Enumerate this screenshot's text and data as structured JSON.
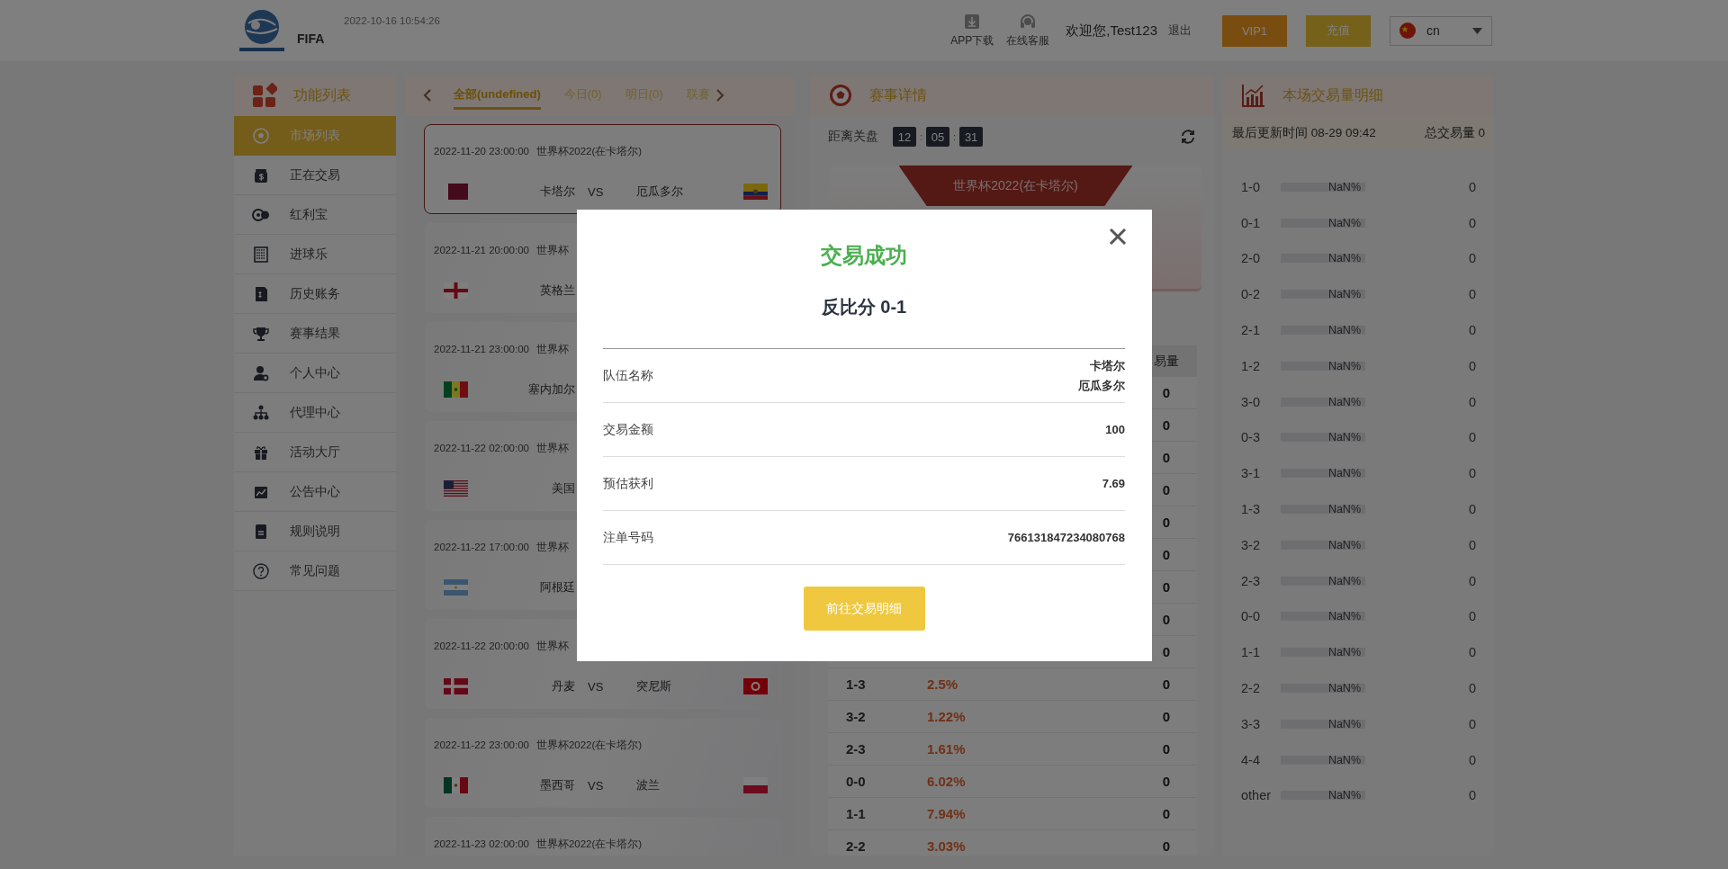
{
  "header": {
    "site_name": "FIFA",
    "datetime": "2022-10-16 10:54:26",
    "links": [
      {
        "label": "APP下载"
      },
      {
        "label": "在线客服"
      }
    ],
    "greeting": "欢迎您,Test123",
    "logout": "退出",
    "buttons": [
      {
        "label": "VIP1",
        "kind": "vip"
      },
      {
        "label": "充值",
        "kind": "recharge"
      }
    ],
    "language": "cn"
  },
  "sidebar": {
    "title": "功能列表",
    "items": [
      {
        "label": "市场列表",
        "selected": true
      },
      {
        "label": "正在交易",
        "selected": false
      },
      {
        "label": "红利宝",
        "selected": false
      },
      {
        "label": "进球乐",
        "selected": false
      },
      {
        "label": "历史账务",
        "selected": false
      },
      {
        "label": "赛事结果",
        "selected": false
      },
      {
        "label": "个人中心",
        "selected": false
      },
      {
        "label": "代理中心",
        "selected": false
      },
      {
        "label": "活动大厅",
        "selected": false
      },
      {
        "label": "公告中心",
        "selected": false
      },
      {
        "label": "规则说明",
        "selected": false
      },
      {
        "label": "常见问题",
        "selected": false
      }
    ]
  },
  "match_list": {
    "tabs": [
      {
        "label": "全部(undefined)",
        "selected": true
      },
      {
        "label": "今日(0)",
        "selected": false
      },
      {
        "label": "明日(0)",
        "selected": false
      },
      {
        "label": "联赛",
        "selected": false
      }
    ],
    "matches": [
      {
        "time": "2022-11-20 23:00:00",
        "league": "世界杯2022(在卡塔尔)",
        "home": "卡塔尔",
        "vs": "VS",
        "away": "厄瓜多尔",
        "selected": true
      },
      {
        "time": "2022-11-21 20:00:00",
        "league": "世界杯",
        "home": "英格兰",
        "selected": false
      },
      {
        "time": "2022-11-21 23:00:00",
        "league": "世界杯",
        "home": "塞内加尔",
        "selected": false
      },
      {
        "time": "2022-11-22 02:00:00",
        "league": "世界杯",
        "home": "美国",
        "selected": false
      },
      {
        "time": "2022-11-22 17:00:00",
        "league": "世界杯",
        "home": "阿根廷",
        "selected": false
      },
      {
        "time": "2022-11-22 20:00:00",
        "league": "世界杯",
        "home": "丹麦",
        "vs": "VS",
        "away": "突尼斯",
        "selected": false
      },
      {
        "time": "2022-11-22 23:00:00",
        "league": "世界杯2022(在卡塔尔)",
        "home": "墨西哥",
        "vs": "VS",
        "away": "波兰",
        "selected": false
      },
      {
        "time": "2022-11-23 02:00:00",
        "league": "世界杯2022(在卡塔尔)",
        "selected": false
      }
    ]
  },
  "match_detail": {
    "title": "赛事详情",
    "countdown": {
      "label": "距离关盘",
      "parts": [
        "12",
        "05",
        "31"
      ],
      "separator": ":"
    },
    "banner": "世界杯2022(在卡塔尔)",
    "table": {
      "header_volume": "易量",
      "rows": [
        {
          "volume": "0"
        },
        {
          "volume": "0"
        },
        {
          "volume": "0"
        },
        {
          "volume": "0"
        },
        {
          "volume": "0"
        },
        {
          "volume": "0"
        },
        {
          "volume": "0"
        },
        {
          "volume": "0"
        },
        {
          "volume": "0"
        },
        {
          "score": "1-3",
          "odds": "2.5%",
          "volume": "0"
        },
        {
          "score": "3-2",
          "odds": "1.22%",
          "volume": "0"
        },
        {
          "score": "2-3",
          "odds": "1.61%",
          "volume": "0"
        },
        {
          "score": "0-0",
          "odds": "6.02%",
          "volume": "0"
        },
        {
          "score": "1-1",
          "odds": "7.94%",
          "volume": "0"
        },
        {
          "score": "2-2",
          "odds": "3.03%",
          "volume": "0"
        }
      ]
    }
  },
  "volume_panel": {
    "title": "本场交易量明细",
    "updated": "最后更新时间 08-29 09:42",
    "total": "总交易量 0",
    "rows": [
      {
        "score": "1-0",
        "percent": "NaN%",
        "volume": "0"
      },
      {
        "score": "0-1",
        "percent": "NaN%",
        "volume": "0"
      },
      {
        "score": "2-0",
        "percent": "NaN%",
        "volume": "0"
      },
      {
        "score": "0-2",
        "percent": "NaN%",
        "volume": "0"
      },
      {
        "score": "2-1",
        "percent": "NaN%",
        "volume": "0"
      },
      {
        "score": "1-2",
        "percent": "NaN%",
        "volume": "0"
      },
      {
        "score": "3-0",
        "percent": "NaN%",
        "volume": "0"
      },
      {
        "score": "0-3",
        "percent": "NaN%",
        "volume": "0"
      },
      {
        "score": "3-1",
        "percent": "NaN%",
        "volume": "0"
      },
      {
        "score": "1-3",
        "percent": "NaN%",
        "volume": "0"
      },
      {
        "score": "3-2",
        "percent": "NaN%",
        "volume": "0"
      },
      {
        "score": "2-3",
        "percent": "NaN%",
        "volume": "0"
      },
      {
        "score": "0-0",
        "percent": "NaN%",
        "volume": "0"
      },
      {
        "score": "1-1",
        "percent": "NaN%",
        "volume": "0"
      },
      {
        "score": "2-2",
        "percent": "NaN%",
        "volume": "0"
      },
      {
        "score": "3-3",
        "percent": "NaN%",
        "volume": "0"
      },
      {
        "score": "4-4",
        "percent": "NaN%",
        "volume": "0"
      },
      {
        "score": "other",
        "percent": "NaN%",
        "volume": "0"
      }
    ]
  },
  "modal": {
    "title": "交易成功",
    "subtitle": "反比分 0-1",
    "rows": [
      {
        "label": "队伍名称",
        "values": [
          "卡塔尔",
          "厄瓜多尔"
        ]
      },
      {
        "label": "交易金额",
        "values": [
          "100"
        ]
      },
      {
        "label": "预估获利",
        "values": [
          "7.69"
        ]
      },
      {
        "label": "注单号码",
        "values": [
          "766131847234080768"
        ]
      }
    ],
    "button": "前往交易明细"
  }
}
